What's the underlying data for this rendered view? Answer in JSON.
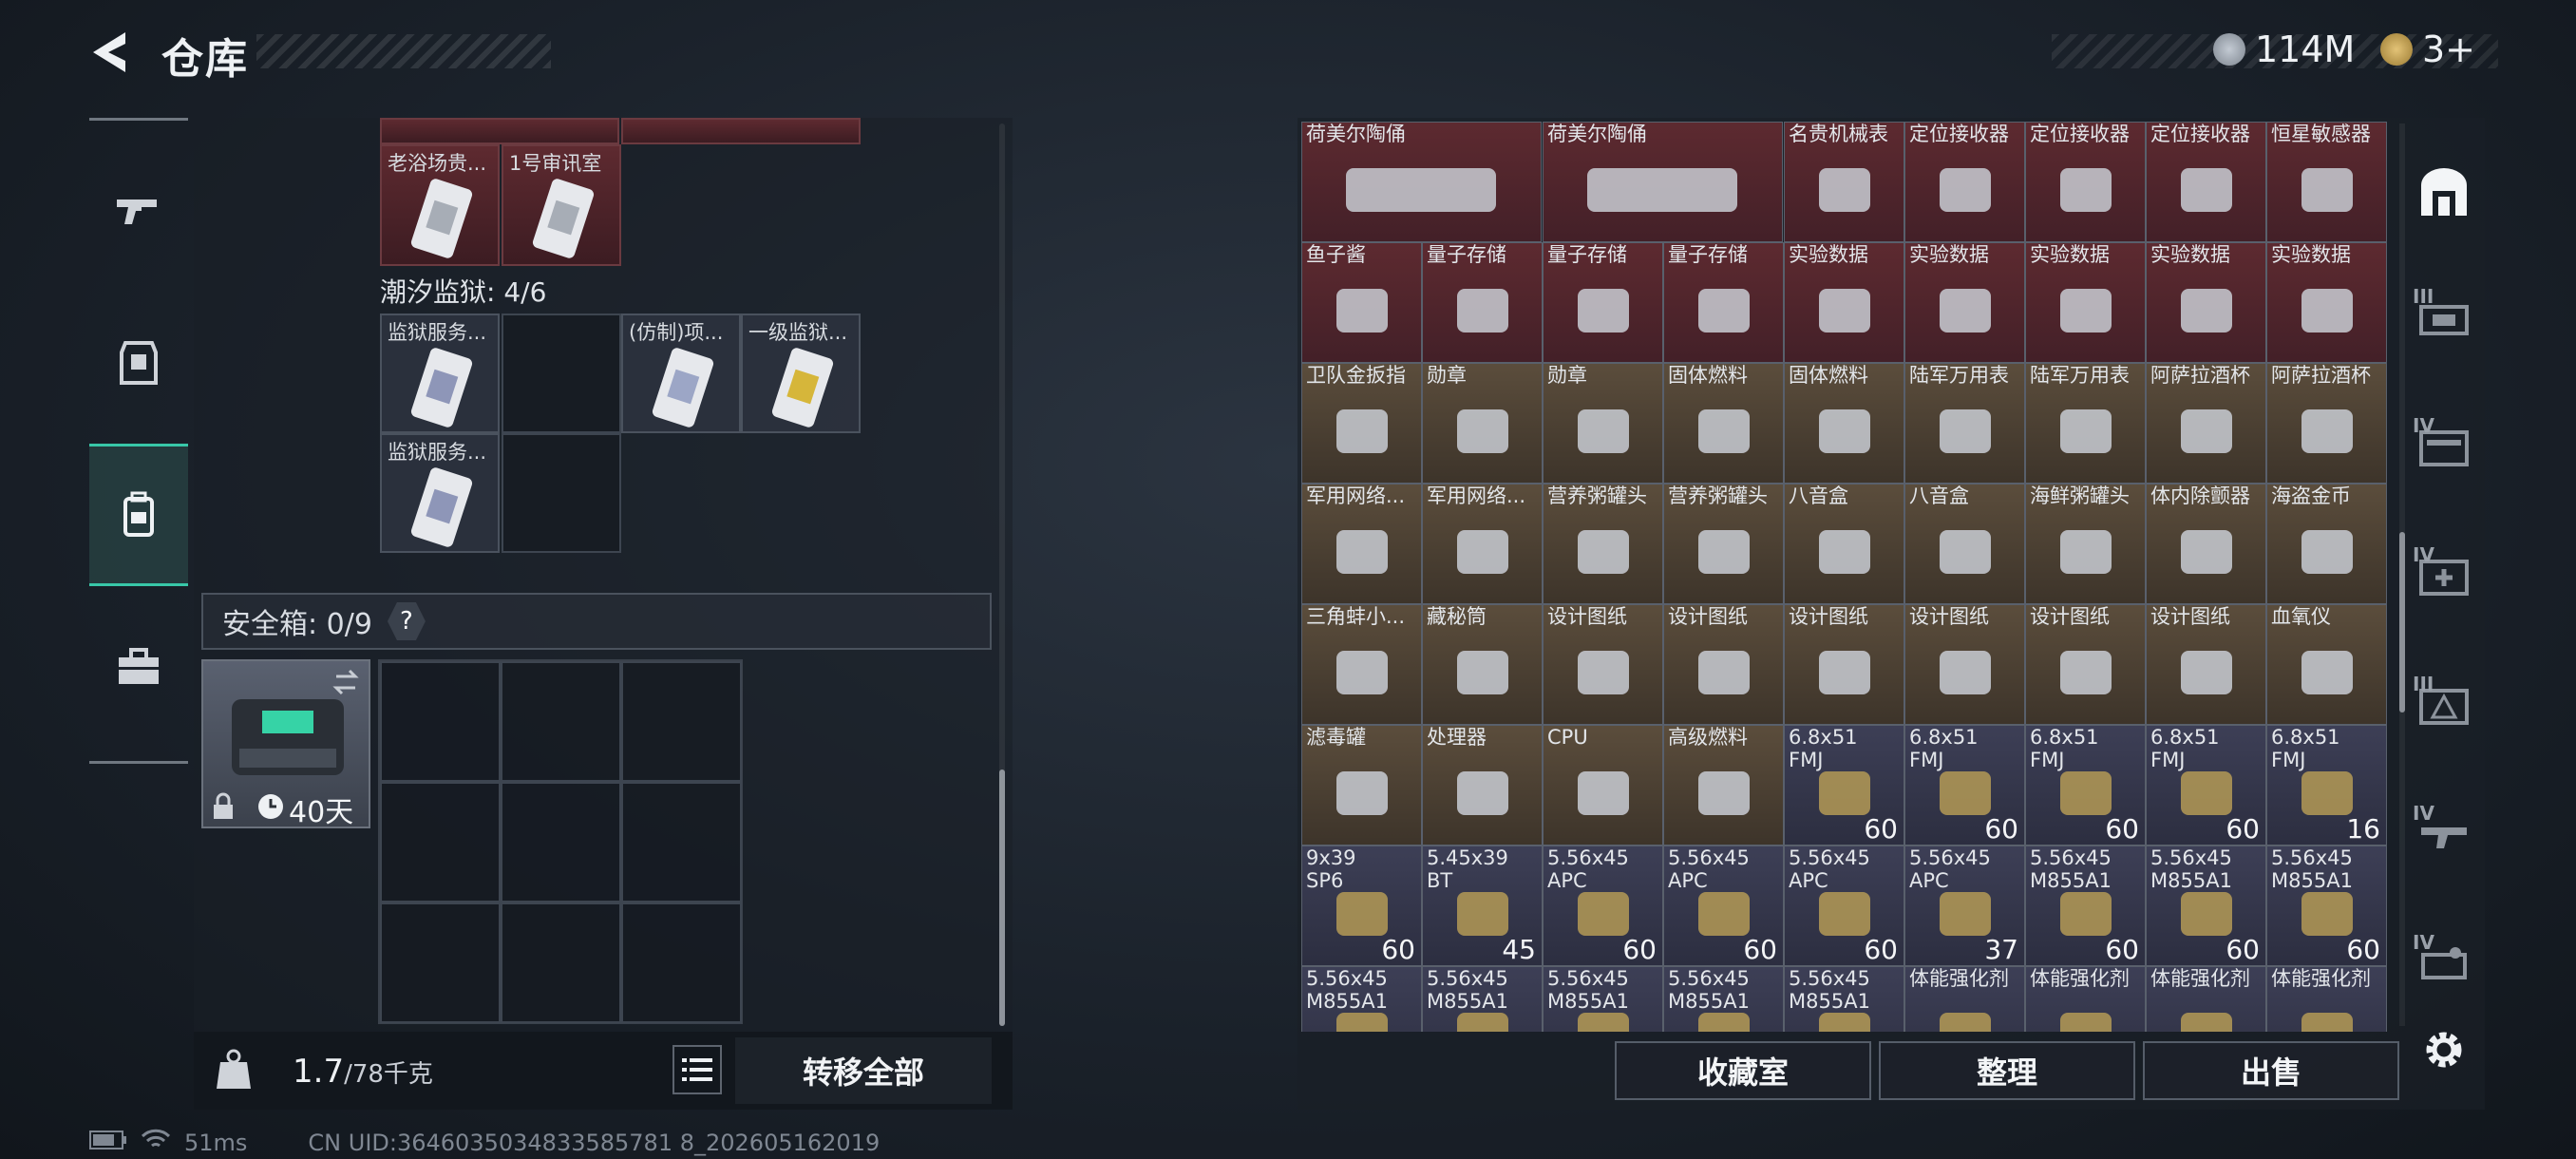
{
  "header": {
    "title": "仓库",
    "currency": [
      {
        "value": "114M",
        "icon": "silver-coin-icon",
        "color": "#9ea7b2"
      },
      {
        "value": "3+",
        "icon": "gold-triangle-coin-icon",
        "color": "#c9a552"
      }
    ]
  },
  "left_nav": {
    "items": [
      {
        "icon": "gun-icon"
      },
      {
        "icon": "armor-icon"
      },
      {
        "icon": "backpack-icon",
        "active": true
      },
      {
        "icon": "toolbox-icon"
      }
    ]
  },
  "left_panel": {
    "top_cards": [
      {
        "label": "老浴场贵..."
      },
      {
        "label": "1号审讯室"
      }
    ],
    "prison_title": "潮汐监狱: 4/6",
    "prison_cards": [
      {
        "label": "监狱服务..."
      },
      {
        "label": "(仿制)项..."
      },
      {
        "label": "一级监狱..."
      },
      {
        "label": "监狱服务..."
      }
    ],
    "safebox_label": "安全箱: 0/9",
    "safebox_help": "?",
    "safebox_timer": "40天",
    "weight_value": "1.7",
    "weight_max": "/78千克",
    "transfer_all": "转移全部"
  },
  "status_bar": {
    "ping": "51ms",
    "uid": "CN UID:3646035034833585781 8_202605162019"
  },
  "items": {
    "row1": [
      {
        "name": "荷美尔陶俑",
        "color": "red",
        "wide": true
      },
      {
        "name": "荷美尔陶俑",
        "color": "red",
        "wide": true
      },
      {
        "name": "名贵机械表",
        "color": "red"
      },
      {
        "name": "定位接收器",
        "color": "red"
      },
      {
        "name": "定位接收器",
        "color": "red"
      },
      {
        "name": "定位接收器",
        "color": "red"
      },
      {
        "name": "恒星敏感器",
        "color": "red"
      }
    ],
    "row2": [
      {
        "name": "鱼子酱",
        "color": "red"
      },
      {
        "name": "量子存储",
        "color": "red"
      },
      {
        "name": "量子存储",
        "color": "red"
      },
      {
        "name": "量子存储",
        "color": "red"
      },
      {
        "name": "实验数据",
        "color": "red"
      },
      {
        "name": "实验数据",
        "color": "red"
      },
      {
        "name": "实验数据",
        "color": "red"
      },
      {
        "name": "实验数据",
        "color": "red"
      },
      {
        "name": "实验数据",
        "color": "red"
      }
    ],
    "row3": [
      {
        "name": "卫队金扳指",
        "color": "gold"
      },
      {
        "name": "勋章",
        "color": "gold"
      },
      {
        "name": "勋章",
        "color": "gold"
      },
      {
        "name": "固体燃料",
        "color": "gold"
      },
      {
        "name": "固体燃料",
        "color": "gold"
      },
      {
        "name": "陆军万用表",
        "color": "gold"
      },
      {
        "name": "陆军万用表",
        "color": "gold"
      },
      {
        "name": "阿萨拉酒杯",
        "color": "gold"
      },
      {
        "name": "阿萨拉酒杯",
        "color": "gold"
      }
    ],
    "row4": [
      {
        "name": "军用网络...",
        "color": "gold"
      },
      {
        "name": "军用网络...",
        "color": "gold"
      },
      {
        "name": "营养粥罐头",
        "color": "gold"
      },
      {
        "name": "营养粥罐头",
        "color": "gold"
      },
      {
        "name": "八音盒",
        "color": "gold"
      },
      {
        "name": "八音盒",
        "color": "gold"
      },
      {
        "name": "海鲜粥罐头",
        "color": "gold"
      },
      {
        "name": "体内除颤器",
        "color": "gold"
      },
      {
        "name": "海盗金币",
        "color": "gold"
      }
    ],
    "row5": [
      {
        "name": "三角蚌小...",
        "color": "gold"
      },
      {
        "name": "藏秘筒",
        "color": "gold"
      },
      {
        "name": "设计图纸",
        "color": "gold"
      },
      {
        "name": "设计图纸",
        "color": "gold"
      },
      {
        "name": "设计图纸",
        "color": "gold"
      },
      {
        "name": "设计图纸",
        "color": "gold"
      },
      {
        "name": "设计图纸",
        "color": "gold"
      },
      {
        "name": "设计图纸",
        "color": "gold"
      },
      {
        "name": "血氧仪",
        "color": "gold"
      }
    ],
    "row6": [
      {
        "name": "滤毒罐",
        "color": "gold"
      },
      {
        "name": "处理器",
        "color": "gold"
      },
      {
        "name": "CPU",
        "color": "gold"
      },
      {
        "name": "高级燃料",
        "color": "gold"
      },
      {
        "name": "6.8x51 FMJ",
        "color": "purple",
        "count": "60"
      },
      {
        "name": "6.8x51 FMJ",
        "color": "purple",
        "count": "60"
      },
      {
        "name": "6.8x51 FMJ",
        "color": "purple",
        "count": "60"
      },
      {
        "name": "6.8x51 FMJ",
        "color": "purple",
        "count": "60"
      },
      {
        "name": "6.8x51 FMJ",
        "color": "purple",
        "count": "16"
      }
    ],
    "row7": [
      {
        "name": "9x39 SP6",
        "color": "purple",
        "count": "60"
      },
      {
        "name": "5.45x39 BT",
        "color": "purple",
        "count": "45"
      },
      {
        "name": "5.56x45 APC",
        "color": "purple",
        "count": "60"
      },
      {
        "name": "5.56x45 APC",
        "color": "purple",
        "count": "60"
      },
      {
        "name": "5.56x45 APC",
        "color": "purple",
        "count": "60"
      },
      {
        "name": "5.56x45 APC",
        "color": "purple",
        "count": "37"
      },
      {
        "name": "5.56x45 M855A1",
        "color": "purple",
        "count": "60"
      },
      {
        "name": "5.56x45 M855A1",
        "color": "purple",
        "count": "60"
      },
      {
        "name": "5.56x45 M855A1",
        "color": "purple",
        "count": "60"
      }
    ],
    "row8": [
      {
        "name": "5.56x45 M855A1",
        "color": "purple"
      },
      {
        "name": "5.56x45 M855A1",
        "color": "purple"
      },
      {
        "name": "5.56x45 M855A1",
        "color": "purple"
      },
      {
        "name": "5.56x45 M855A1",
        "color": "purple"
      },
      {
        "name": "5.56x45 M855A1",
        "color": "purple"
      },
      {
        "name": "体能强化剂",
        "color": "purple"
      },
      {
        "name": "体能强化剂",
        "color": "purple"
      },
      {
        "name": "体能强化剂",
        "color": "purple"
      },
      {
        "name": "体能强化剂",
        "color": "purple"
      }
    ]
  },
  "actions": {
    "collection": "收藏室",
    "sort": "整理",
    "sell": "出售"
  },
  "right_tabs": [
    {
      "label": "",
      "icon": "vault-icon",
      "active": true
    },
    {
      "label": "III",
      "icon": "storage-tab-3-icon"
    },
    {
      "label": "IV",
      "icon": "storage-tab-4-icon"
    },
    {
      "label": "IV",
      "icon": "storage-tab-4-medical-icon"
    },
    {
      "label": "III",
      "icon": "storage-tab-3-warning-icon"
    },
    {
      "label": "IV",
      "icon": "storage-tab-4-gun-icon"
    },
    {
      "label": "IV",
      "icon": "storage-tab-4-ammo-icon"
    }
  ],
  "settings_icon": "gear-icon"
}
